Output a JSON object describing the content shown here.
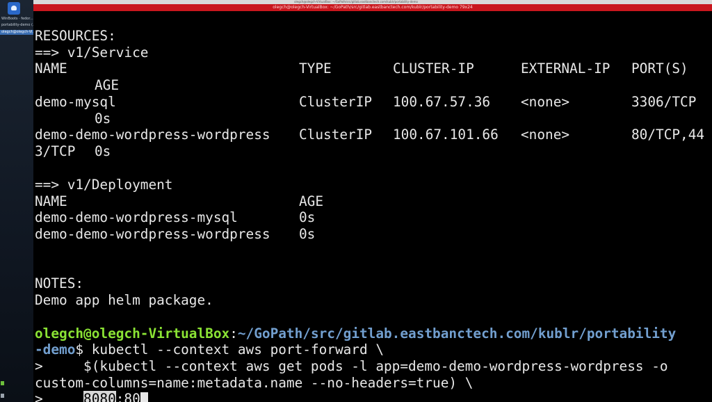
{
  "os_bar": {
    "title": "olegch@olegch-VirtualBox: ~/GoPath/src/gitlab.eastbanctech.com/kublr/portability-demo"
  },
  "window": {
    "title": "olegch@olegch-VirtualBox: ~/GoPath/src/gitlab.eastbanctech.com/kublr/portability-demo 79x24"
  },
  "sidebar": {
    "items": [
      {
        "label": "WinBoots · fedor..."
      },
      {
        "label": "portability-demo (..."
      },
      {
        "label": "olegch@olegch-Vi..."
      }
    ],
    "icons": [
      "app-icon",
      "green-status-icon",
      "speaker-icon"
    ],
    "colors": {
      "accent": "#3b6fb3",
      "status_green": "#6dbf3c"
    }
  },
  "terminal": {
    "resources": {
      "heading": "RESOURCES:",
      "service_header": "==> v1/Service",
      "cols": {
        "name": "NAME",
        "type": "TYPE",
        "cluster_ip": "CLUSTER-IP",
        "external_ip": "EXTERNAL-IP",
        "ports": "PORT(S)",
        "age": "AGE"
      },
      "rows": [
        {
          "name": "demo-mysql",
          "type": "ClusterIP",
          "cluster_ip": "100.67.57.36",
          "external_ip": "<none>",
          "ports": "3306/TCP",
          "age": "0s"
        },
        {
          "name": "demo-demo-wordpress-wordpress",
          "type": "ClusterIP",
          "cluster_ip": "100.67.101.66",
          "external_ip": "<none>",
          "ports": "80/TCP,44",
          "ports_wrap": "3/TCP",
          "age": "0s"
        }
      ]
    },
    "deployment": {
      "header": "==> v1/Deployment",
      "cols": {
        "name": "NAME",
        "age": "AGE"
      },
      "rows": [
        {
          "name": "demo-demo-wordpress-mysql",
          "age": "0s"
        },
        {
          "name": "demo-demo-wordpress-wordpress",
          "age": "0s"
        }
      ]
    },
    "notes": {
      "heading": "NOTES:",
      "text": "Demo app helm package."
    },
    "prompt": {
      "user_host": "olegch@olegch-VirtualBox",
      "sep": ":",
      "path1": "~/GoPath/src/gitlab.eastbanctech.com/kublr/portability",
      "path2": "-demo",
      "symbol": "$"
    },
    "command": {
      "line1": " kubectl --context aws port-forward \\",
      "line2": ">     $(kubectl --context aws get pods -l app=demo-demo-wordpress-wordpress -o",
      "line3": "custom-columns=name:metadata.name --no-headers=true) \\",
      "line4_prefix": ">     ",
      "line4_selected": "8080",
      "line4_rest": ":80"
    },
    "colors": {
      "background": "#000000",
      "text": "#e8e8e8",
      "prompt_user": "#8ae234",
      "prompt_path": "#729fcf",
      "title_bar": "#c9171e"
    }
  }
}
